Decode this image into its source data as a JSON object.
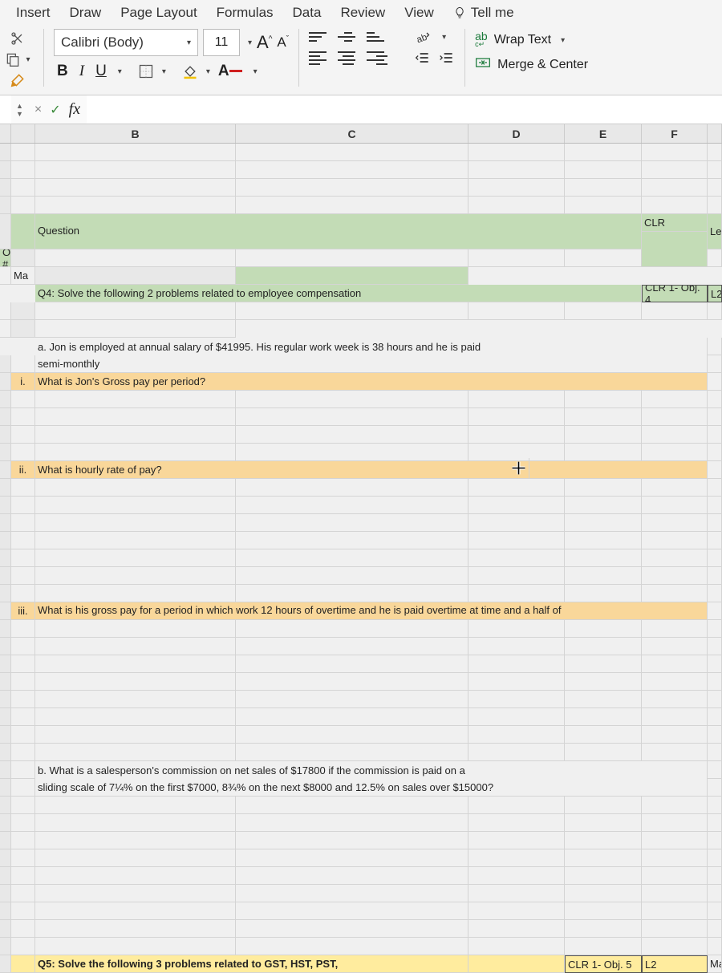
{
  "tabs": {
    "insert": "Insert",
    "draw": "Draw",
    "pageLayout": "Page Layout",
    "formulas": "Formulas",
    "data": "Data",
    "review": "Review",
    "view": "View",
    "tellme": "Tell me"
  },
  "font": {
    "name": "Calibri (Body)",
    "size": "11",
    "bold": "B",
    "italic": "I",
    "underline": "U",
    "bigA": "A",
    "smallA": "A",
    "colorA": "A"
  },
  "wrap": {
    "wrapText": "Wrap Text",
    "merge": "Merge & Center"
  },
  "formulaBar": {
    "cancel": "×",
    "confirm": "✓",
    "fx": "fx"
  },
  "cols": {
    "A": "",
    "B": "B",
    "C": "C",
    "D": "D",
    "E": "E",
    "F": "F"
  },
  "cells": {
    "question": "Question",
    "clr": "CLR",
    "objective": "Objective #",
    "lesson": "Lesson",
    "ma": "Ma",
    "q4": "Q4: Solve the following 2 problems related to employee compensation",
    "clr1_4": "CLR 1- Obj. 4",
    "l2a": "L2",
    "aJon1": "a. Jon is employed at annual salary of $41995.   His regular work week is 38 hours and he is paid",
    "aJon2": "semi-monthly",
    "i": "i.",
    "q_i": "What is Jon's Gross pay per period?",
    "ii": "ii.",
    "q_ii": "What is hourly rate of pay?",
    "iii": "iii.",
    "q_iii": "What is his gross pay for a period in which work 12 hours of overtime and he is paid overtime at time and a half of",
    "b1": "b.    What is a salesperson's commission on net sales of $17800 if the commission is paid on a",
    "b2": "sliding scale of 7¼% on the first $7000, 8¾% on the next $8000 and 12.5% on sales over $15000?",
    "q5": "Q5: Solve the following 3 problems related to GST, HST, PST,",
    "clr1_5": "CLR 1- Obj. 5",
    "l2b": "L2",
    "mark": "Mark"
  }
}
